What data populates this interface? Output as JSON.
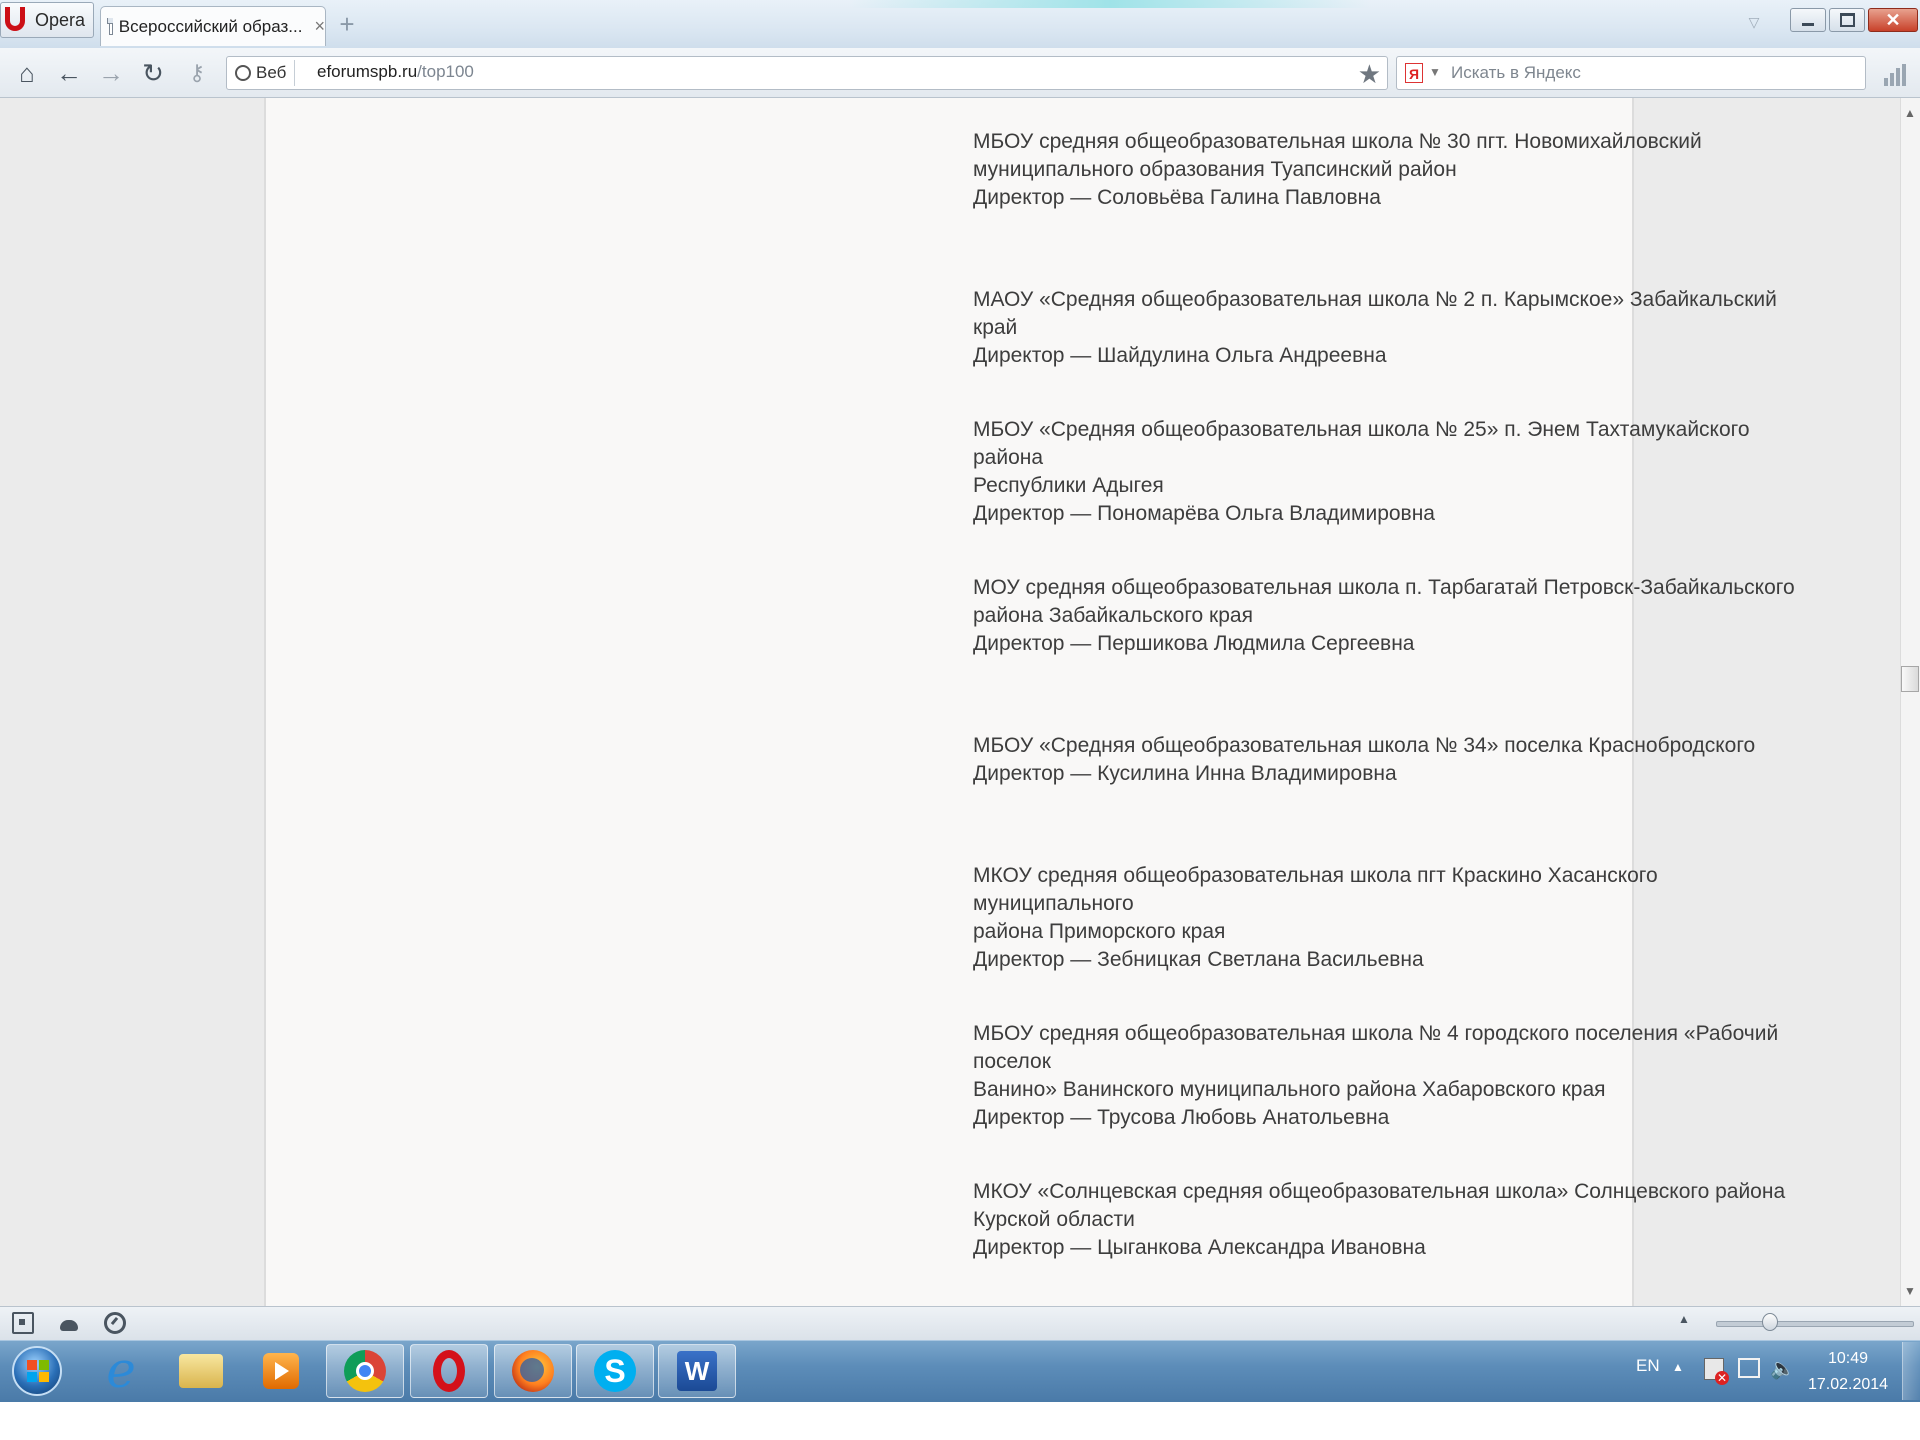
{
  "browser": {
    "menu_label": "Opera",
    "tab_title": "Всероссийский образ...",
    "tab_close": "×",
    "new_tab": "+",
    "address": {
      "mode_label": "Веб",
      "url_domain": "eforumspb.ru",
      "url_path": "/top100"
    },
    "search": {
      "engine_badge": "Я",
      "placeholder": "Искать в Яндекс"
    }
  },
  "icons": {
    "home": "home-icon",
    "back": "arrow-left-icon",
    "forward": "arrow-right-icon",
    "reload": "reload-icon",
    "key": "key-icon",
    "star": "star-icon"
  },
  "entries": [
    {
      "lines": [
        "МБОУ средняя общеобразовательная школа № 30 пгт. Новомихайловский",
        "муниципального образования Туапсинский район",
        "Директор — Соловьёва Галина Павловна"
      ]
    },
    {
      "lines": [
        "МАОУ «Средняя общеобразовательная школа № 2 п. Карымское» Забайкальский край",
        "Директор — Шайдулина Ольга Андреевна"
      ]
    },
    {
      "lines": [
        "МБОУ «Средняя общеобразовательная школа № 25» п. Энем Тахтамукайского района",
        "Республики Адыгея",
        "Директор — Пономарёва Ольга Владимировна"
      ]
    },
    {
      "lines": [
        "МОУ средняя общеобразовательная школа п. Тарбагатай Петровск-Забайкальского",
        "района Забайкальского края",
        "Директор — Першикова Людмила Сергеевна"
      ]
    },
    {
      "lines": [
        "МБОУ «Средняя общеобразовательная школа № 34» поселка Краснобродского",
        "Директор — Кусилина Инна Владимировна"
      ]
    },
    {
      "lines": [
        "МКОУ средняя общеобразовательная школа пгт Краскино Хасанского муниципального",
        "района Приморского края",
        "Директор — Зебницкая Светлана Васильевна"
      ]
    },
    {
      "lines": [
        "МБОУ средняя общеобразовательная школа № 4 городского поселения «Рабочий поселок",
        "Ванино» Ванинского муниципального района Хабаровского края",
        "Директор — Трусова Любовь Анатольевна"
      ]
    },
    {
      "lines": [
        "МКОУ «Солнцевская средняя общеобразовательная школа» Солнцевского района",
        "Курской области",
        "Директор — Цыганкова Александра Ивановна"
      ]
    }
  ],
  "taskbar": {
    "skype_letter": "S",
    "word_letter": "W",
    "ie_letter": "e",
    "tray": {
      "language": "EN",
      "time": "10:49",
      "date": "17.02.2014"
    }
  }
}
